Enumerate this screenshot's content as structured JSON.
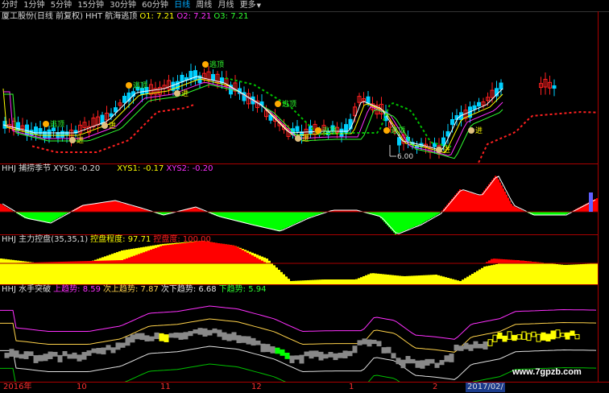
{
  "toolbar": {
    "items": [
      {
        "label": "分时"
      },
      {
        "label": "1分钟"
      },
      {
        "label": "5分钟"
      },
      {
        "label": "15分钟"
      },
      {
        "label": "30分钟"
      },
      {
        "label": "60分钟"
      },
      {
        "label": "日线",
        "active": true
      },
      {
        "label": "周线"
      },
      {
        "label": "月线"
      },
      {
        "label": "更多"
      }
    ],
    "more_arrow": "▼"
  },
  "panel1": {
    "title": "厦工股份(日线 前复权)",
    "indicator": "HHT 航海逃顶",
    "o1": "O1: 7.21",
    "o2": "O2: 7.21",
    "o3": "O3: 7.21",
    "low_label": "6.00",
    "signal_escape": "逃顶",
    "signal_enter": "进"
  },
  "panel2": {
    "title": "HHJ 捕捞季节",
    "xys0": "XYS0: -0.20",
    "xys1": "XYS1: -0.17",
    "xys2": "XYS2: -0.20"
  },
  "panel3": {
    "title": "HHJ 主力控盘(35,35,1)",
    "degree": "控盘程度: 97.71",
    "full": "控盘度: 100.00"
  },
  "panel4": {
    "title": "HHJ 水手突破",
    "up": "上趋势: 8.59",
    "sub_up": "次上趋势: 7.87",
    "sub_down": "次下趋势: 6.68",
    "down": "下趋势: 5.94"
  },
  "xaxis": {
    "labels": [
      "2016年",
      "10",
      "11",
      "12",
      "1",
      "2",
      "2017/02/"
    ]
  },
  "watermark": "www.7gpzb.com",
  "colors": {
    "up": "#ff2020",
    "down": "#00d0ff",
    "fill_red": "#ff0000",
    "fill_green": "#00ff00",
    "fill_yellow": "#ffff00",
    "line_magenta": "#ff30ff",
    "line_yellow": "#ffd24a",
    "line_white": "#e0e0e0",
    "line_green": "#00c000"
  }
}
